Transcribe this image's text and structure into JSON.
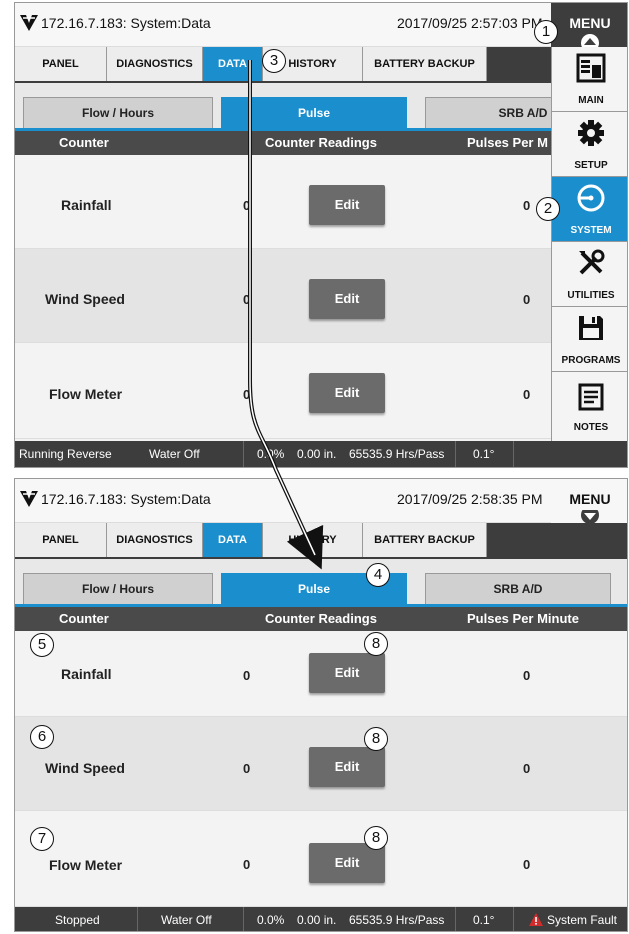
{
  "screen_a": {
    "title": "172.16.7.183: System:Data",
    "datetime": "2017/09/25 2:57:03 PM",
    "menu_label": "MENU",
    "tabs": [
      "PANEL",
      "DIAGNOSTICS",
      "DATA",
      "HISTORY",
      "BATTERY BACKUP"
    ],
    "subtabs": [
      "Flow / Hours",
      "Pulse",
      "SRB A/D"
    ],
    "columns": [
      "Counter",
      "Counter Readings",
      "Pulses Per M"
    ],
    "rows": [
      {
        "name": "Rainfall",
        "reading": "0",
        "edit": "Edit",
        "ppm": "0"
      },
      {
        "name": "Wind Speed",
        "reading": "0",
        "edit": "Edit",
        "ppm": "0"
      },
      {
        "name": "Flow Meter",
        "reading": "0",
        "edit": "Edit",
        "ppm": "0"
      }
    ],
    "status": {
      "state": "Running Reverse",
      "water": "Water Off",
      "percent": "0.0%",
      "depth": "0.00 in.",
      "hrs": "65535.9 Hrs/Pass",
      "angle": "0.1°"
    },
    "side_menu": [
      "MAIN",
      "SETUP",
      "SYSTEM",
      "UTILITIES",
      "PROGRAMS",
      "NOTES"
    ]
  },
  "screen_b": {
    "title": "172.16.7.183: System:Data",
    "datetime": "2017/09/25 2:58:35 PM",
    "menu_label": "MENU",
    "tabs": [
      "PANEL",
      "DIAGNOSTICS",
      "DATA",
      "HISTORY",
      "BATTERY BACKUP"
    ],
    "subtabs": [
      "Flow / Hours",
      "Pulse",
      "SRB A/D"
    ],
    "columns": [
      "Counter",
      "Counter Readings",
      "Pulses Per Minute"
    ],
    "rows": [
      {
        "name": "Rainfall",
        "reading": "0",
        "edit": "Edit",
        "ppm": "0"
      },
      {
        "name": "Wind Speed",
        "reading": "0",
        "edit": "Edit",
        "ppm": "0"
      },
      {
        "name": "Flow Meter",
        "reading": "0",
        "edit": "Edit",
        "ppm": "0"
      }
    ],
    "status": {
      "state": "Stopped",
      "water": "Water Off",
      "percent": "0.0%",
      "depth": "0.00 in.",
      "hrs": "65535.9 Hrs/Pass",
      "angle": "0.1°",
      "fault": "System Fault"
    }
  },
  "callouts": [
    "1",
    "2",
    "3",
    "4",
    "5",
    "6",
    "7",
    "8",
    "8",
    "8"
  ],
  "colors": {
    "accent_blue": "#1b8fce",
    "dark_bar": "#3d3d3d",
    "fault_red": "#d22b2b"
  },
  "icons": [
    "logo-icon",
    "menu-up-arrow-icon",
    "menu-down-arrow-icon",
    "main-icon",
    "gear-icon",
    "system-icon",
    "tools-icon",
    "floppy-disk-icon",
    "notes-icon",
    "warning-icon"
  ]
}
